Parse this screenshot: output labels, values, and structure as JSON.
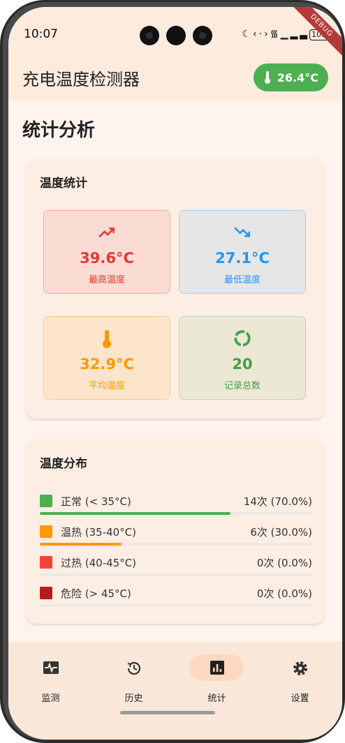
{
  "status_bar": {
    "time": "10:07",
    "battery": "100",
    "debug_banner": "DEBUG"
  },
  "app_bar": {
    "title": "充电温度检测器",
    "current_temp": "26.4°C"
  },
  "page": {
    "title": "统计分析"
  },
  "temperature_stats": {
    "title": "温度统计",
    "cards": [
      {
        "value": "39.6°C",
        "label": "最高温度",
        "icon": "trending-up-icon",
        "color": "#e53935",
        "bg": "#fbdcd4",
        "border": "#f1a9a0"
      },
      {
        "value": "27.1°C",
        "label": "最低温度",
        "icon": "trending-down-icon",
        "color": "#2196f3",
        "bg": "#e6e6e6",
        "border": "#a9cbe9"
      },
      {
        "value": "32.9°C",
        "label": "平均温度",
        "icon": "thermometer-icon",
        "color": "#ff9800",
        "bg": "#fde5cc",
        "border": "#f7c990"
      },
      {
        "value": "20",
        "label": "记录总数",
        "icon": "donut-icon",
        "color": "#43a047",
        "bg": "#ece8d6",
        "border": "#b8d3b0"
      }
    ]
  },
  "temperature_distribution": {
    "title": "温度分布",
    "rows": [
      {
        "label": "正常 (< 35°C)",
        "count": "14次 (70.0%)",
        "fraction": 0.7,
        "color": "#4caf50"
      },
      {
        "label": "温热 (35-40°C)",
        "count": "6次 (30.0%)",
        "fraction": 0.3,
        "color": "#ff9800"
      },
      {
        "label": "过热 (40-45°C)",
        "count": "0次 (0.0%)",
        "fraction": 0.0,
        "color": "#f44336"
      },
      {
        "label": "危险 (> 45°C)",
        "count": "0次 (0.0%)",
        "fraction": 0.0,
        "color": "#b71c1c"
      }
    ]
  },
  "bottom_nav": {
    "items": [
      {
        "label": "监测",
        "icon": "monitor-heart-icon",
        "active": false
      },
      {
        "label": "历史",
        "icon": "history-icon",
        "active": false
      },
      {
        "label": "统计",
        "icon": "bar-chart-icon",
        "active": true
      },
      {
        "label": "设置",
        "icon": "settings-gear-icon",
        "active": false
      }
    ]
  },
  "colors": {
    "accent": "#4caf50",
    "app_bar_bg": "#fdebdd",
    "page_bg": "#fff3ee"
  }
}
